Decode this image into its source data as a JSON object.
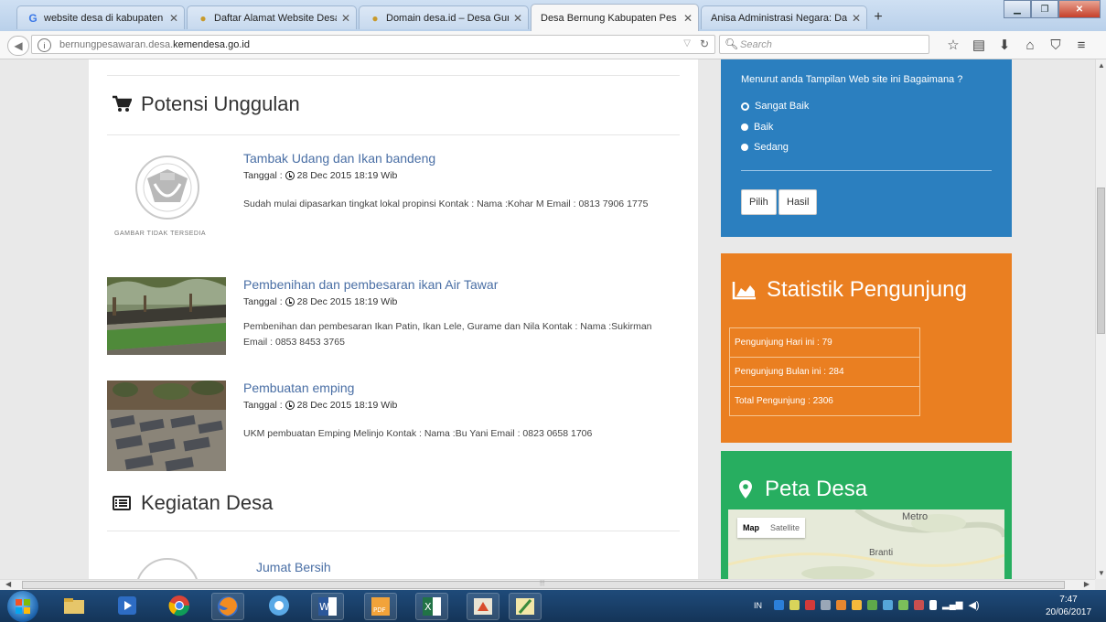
{
  "browser": {
    "tabs": [
      {
        "label": "website desa di kabupaten pe",
        "icon": "google-icon"
      },
      {
        "label": "Daftar Alamat Website Desa",
        "icon": "pin-icon"
      },
      {
        "label": "Domain desa.id – Desa Gunu",
        "icon": "pin-icon"
      },
      {
        "label": "Desa Bernung Kabupaten Pes",
        "icon": "none",
        "active": true
      },
      {
        "label": "Anisa Administrasi Negara: Data",
        "icon": "none"
      }
    ],
    "url_prefix": "bernungpesawaran.desa.",
    "url_domain": "kemendesa.go.id",
    "search_placeholder": "Search"
  },
  "main": {
    "potensi": {
      "title": "Potensi Unggulan",
      "posts": [
        {
          "title": "Tambak Udang dan Ikan bandeng",
          "date_label": "Tanggal :",
          "date": "28 Dec 2015 18:19 Wib",
          "description": "Sudah mulai dipasarkan tingkat lokal propinsi Kontak : Nama :Kohar M Email : 0813 7906 1775",
          "image": "no-image-placeholder",
          "image_caption": "GAMBAR TIDAK TERSEDIA"
        },
        {
          "title": "Pembenihan dan pembesaran ikan Air Tawar",
          "date_label": "Tanggal :",
          "date": "28 Dec 2015 18:19 Wib",
          "description": "Pembenihan dan pembesaran Ikan Patin, Ikan Lele, Gurame dan Nila Kontak : Nama :Sukirman Email : 0853 8453 3765",
          "image": "fish-pond-photo"
        },
        {
          "title": "Pembuatan emping",
          "date_label": "Tanggal :",
          "date": "28 Dec 2015 18:19 Wib",
          "description": "UKM pembuatan Emping Melinjo Kontak : Nama :Bu Yani Email : 0823 0658 1706",
          "image": "emping-drying-photo"
        }
      ]
    },
    "kegiatan": {
      "title": "Kegiatan Desa",
      "posts": [
        {
          "title": "Jumat Bersih"
        }
      ]
    }
  },
  "sidebar": {
    "poll": {
      "question": "Menurut anda Tampilan Web site ini Bagaimana ?",
      "options": [
        "Sangat Baik",
        "Baik",
        "Sedang"
      ],
      "selected": "Sangat Baik",
      "vote_button": "Pilih",
      "result_button": "Hasil",
      "color": "#2b7fbf"
    },
    "stats": {
      "title": "Statistik Pengunjung",
      "rows": [
        "Pengunjung Hari ini : 79",
        "Pengunjung Bulan ini : 284",
        "Total Pengunjung : 2306"
      ],
      "color": "#ea7f21"
    },
    "map": {
      "title": "Peta Desa",
      "type_map": "Map",
      "type_satellite": "Satellite",
      "labels": [
        "Metro",
        "Branti"
      ],
      "color": "#27ae60"
    }
  },
  "taskbar": {
    "language": "IN",
    "time": "7:47",
    "date": "20/06/2017"
  }
}
